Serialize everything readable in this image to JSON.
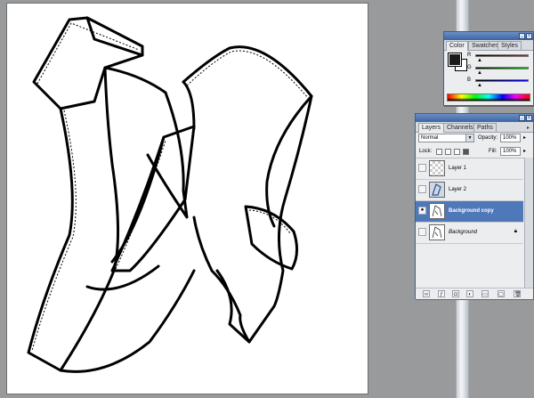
{
  "color_panel": {
    "tabs": [
      "Color",
      "Swatches",
      "Styles"
    ],
    "channels": [
      "R",
      "G",
      "B"
    ],
    "foreground_color": "#1a1a1a",
    "background_color": "#ffffff"
  },
  "layers_panel": {
    "tabs": [
      "Layers",
      "Channels",
      "Paths"
    ],
    "blend_mode": "Normal",
    "opacity_label": "Opacity:",
    "opacity_value": "100%",
    "lock_label": "Lock:",
    "fill_label": "Fill:",
    "fill_value": "100%",
    "layers": [
      {
        "name": "Layer 1",
        "visible": false,
        "selected": false
      },
      {
        "name": "Layer 2",
        "visible": false,
        "selected": false
      },
      {
        "name": "Background copy",
        "visible": true,
        "selected": true
      },
      {
        "name": "Background",
        "visible": false,
        "selected": false,
        "locked": true
      }
    ]
  },
  "icons": {
    "eye": "eye-icon",
    "lock": "lock-icon",
    "footer": [
      "link-icon",
      "layer-style-icon",
      "mask-icon",
      "adjustment-icon",
      "group-icon",
      "new-layer-icon",
      "trash-icon"
    ]
  },
  "colors": {
    "titlebar": "#4a72b0",
    "selected_layer": "#4f78b9",
    "workspace": "#999a9c"
  }
}
